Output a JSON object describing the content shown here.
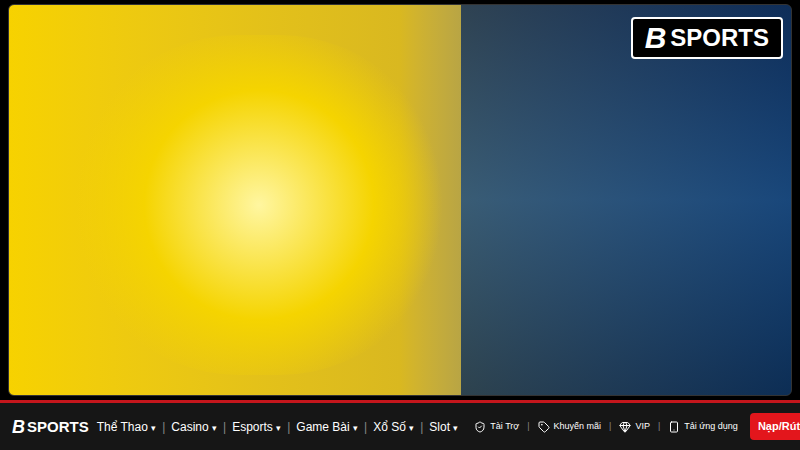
{
  "game_frame": {
    "watermark": {
      "mark": "B",
      "text": "SPORTS"
    }
  },
  "nav": {
    "logo": {
      "mark": "B",
      "text": "SPORTS"
    },
    "menu": [
      {
        "label": "Thể Thao",
        "caret": "▾"
      },
      {
        "label": "Casino",
        "caret": "▾"
      },
      {
        "label": "Esports",
        "caret": "▾"
      },
      {
        "label": "Game Bài",
        "caret": "▾"
      },
      {
        "label": "Xổ Số",
        "caret": "▾"
      },
      {
        "label": "Slot",
        "caret": "▾"
      }
    ],
    "separator": "|",
    "links": [
      {
        "label": "Tài Trợ",
        "kind": "sponsor"
      },
      {
        "label": "Khuyến mãi",
        "kind": "promo"
      },
      {
        "label": "VIP",
        "kind": "vip"
      },
      {
        "label": "Tải ứng dụng",
        "kind": "app"
      }
    ],
    "button": "Nạp/Rút"
  }
}
